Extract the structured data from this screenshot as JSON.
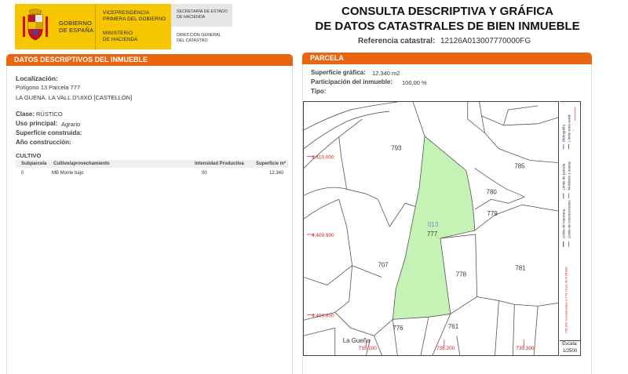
{
  "header": {
    "gov_line1": "GOBIERNO",
    "gov_line2": "DE ESPAÑA",
    "vp_line1": "VICEPRESIDENCIA",
    "vp_line2": "PRIMERA DEL GOBIERNO",
    "min_line1": "MINISTERIO",
    "min_line2": "DE HACIENDA",
    "sec_line1": "SECRETARÍA DE ESTADO",
    "sec_line2": "DE HACIENDA",
    "dir_line1": "DIRECCIÓN GENERAL",
    "dir_line2": "DEL CATASTRO",
    "title_line1": "CONSULTA DESCRIPTIVA Y GRÁFICA",
    "title_line2": "DE DATOS CATASTRALES DE BIEN INMUEBLE",
    "ref_label": "Referencia catastral:",
    "ref_value": "12126A013007770000FG"
  },
  "left": {
    "section_title": "DATOS DESCRIPTIVOS DEL INMUEBLE",
    "localizacion_label": "Localización:",
    "localizacion_line1": "Polígono 13 Parcela 777",
    "localizacion_line2": "LA GUENA. LA VALL D'UIXO [CASTELLÓN]",
    "clase_label": "Clase:",
    "clase_value": "RÚSTICO",
    "uso_label": "Uso principal:",
    "uso_value": "Agrario",
    "superficie_label": "Superficie construida:",
    "anio_label": "Año construcción:",
    "cultivo_title": "CULTIVO",
    "cultivo_headers": [
      "Subparcela",
      "Cultivo/aprovechamiento",
      "Intensidad Productiva",
      "Superficie m²"
    ],
    "cultivo_rows": [
      [
        "0",
        "MB Monte bajo",
        "00",
        "12.340"
      ]
    ]
  },
  "right": {
    "section_title": "PARCELA",
    "sup_grafica_label": "Superficie gráfica:",
    "sup_grafica_value": "12.340 m2",
    "participacion_label": "Participación del inmueble:",
    "participacion_value": "100,00 %",
    "tipo_label": "Tipo:"
  },
  "map": {
    "parcel_labels": [
      "793",
      "785",
      "780",
      "779",
      "777",
      "013",
      "707",
      "778",
      "781",
      "776",
      "761"
    ],
    "y_coords": [
      "4.410.000",
      "4.409.900",
      "4.409.800"
    ],
    "x_coords": [
      "735.100",
      "735.200",
      "735.300"
    ],
    "place_name": "La Gueña",
    "legend_items": [
      "Hidrografía",
      "Límite zona verde",
      "Límite de parcela",
      "Mobiliario y aceras",
      "Límite de manzana",
      "Límite de construcciones"
    ],
    "projection_note": "735.300 Coordenadas U.T.M. Huso 30 ETRS89",
    "scale_label": "Escala:",
    "scale_value": "1/2500",
    "colors": {
      "highlight": "#c5f2b5",
      "coord": "#cc2222",
      "parcel_line": "#555555"
    }
  }
}
